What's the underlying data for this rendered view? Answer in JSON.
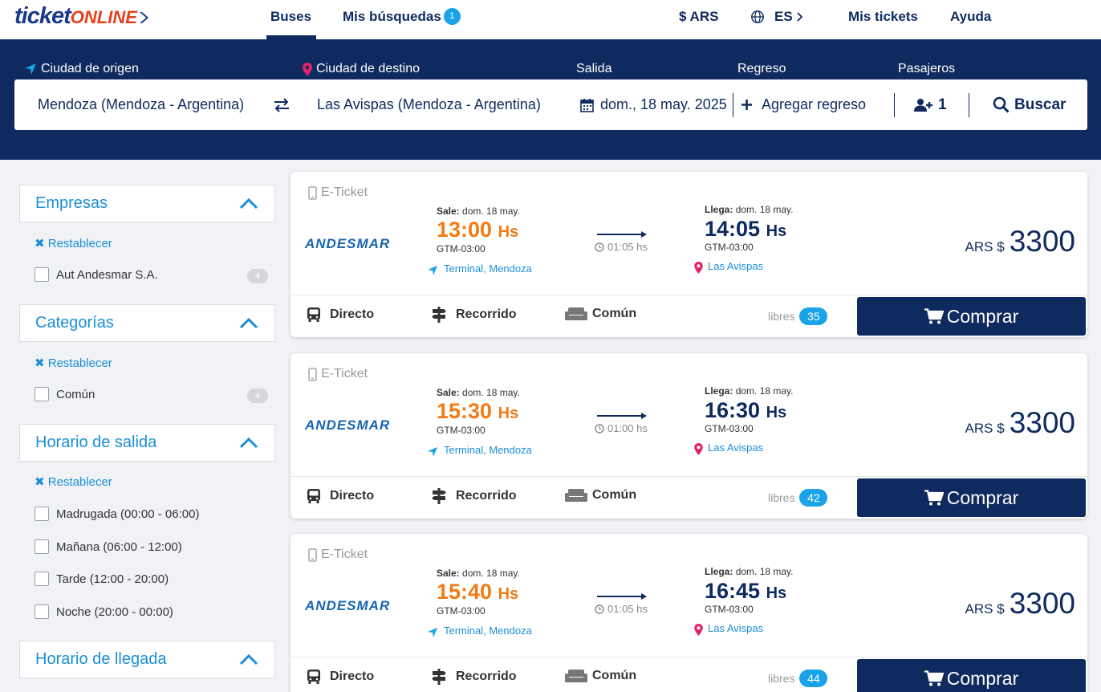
{
  "nav": {
    "logo_part1": "ticket",
    "logo_part2": "ONLINE",
    "buses": "Buses",
    "mis_busquedas": "Mis búsquedas",
    "mis_busquedas_badge": "1",
    "currency": "$ ARS",
    "language": "ES",
    "mis_tickets": "Mis tickets",
    "ayuda": "Ayuda"
  },
  "search": {
    "origin_label": "Ciudad de origen",
    "destination_label": "Ciudad de destino",
    "departure_label": "Salida",
    "return_label": "Regreso",
    "passengers_label": "Pasajeros",
    "origin_value": "Mendoza (Mendoza - Argentina)",
    "destination_value": "Las Avispas (Mendoza - Argentina)",
    "departure_value": "dom., 18 may. 2025",
    "return_value": "Agregar regreso",
    "passengers_value": "1",
    "search_button": "Buscar"
  },
  "filters": {
    "reset_label": "Restablecer",
    "empresas": {
      "title": "Empresas",
      "options": [
        {
          "label": "Aut Andesmar S.A.",
          "count": "4"
        }
      ]
    },
    "categorias": {
      "title": "Categorías",
      "options": [
        {
          "label": "Común",
          "count": "4"
        }
      ]
    },
    "horario_salida": {
      "title": "Horario de salida",
      "options": [
        {
          "label": "Madrugada (00:00 - 06:00)"
        },
        {
          "label": "Mañana (06:00 - 12:00)"
        },
        {
          "label": "Tarde (12:00 - 20:00)"
        },
        {
          "label": "Noche (20:00 - 00:00)"
        }
      ]
    },
    "horario_llegada": {
      "title": "Horario de llegada"
    }
  },
  "results": [
    {
      "ticket_type": "E-Ticket",
      "company": "ANDESMAR",
      "sale_label": "Sale:",
      "sale_date": "dom. 18 may.",
      "departure_time": "13:00",
      "departure_hs": "Hs",
      "departure_tz": "GTM-03:00",
      "departure_place": "Terminal, Mendoza",
      "duration": "01:05 hs",
      "arrival_label": "Llega:",
      "arrival_date": "dom. 18 may.",
      "arrival_time": "14:05",
      "arrival_hs": "Hs",
      "arrival_tz": "GTM-03:00",
      "arrival_place": "Las Avispas",
      "price_currency": "ARS $",
      "price": "3300",
      "feature_direct": "Directo",
      "feature_route": "Recorrido",
      "feature_class": "Común",
      "seats_label": "libres",
      "seats": "35",
      "buy_label": "Comprar"
    },
    {
      "ticket_type": "E-Ticket",
      "company": "ANDESMAR",
      "sale_label": "Sale:",
      "sale_date": "dom. 18 may.",
      "departure_time": "15:30",
      "departure_hs": "Hs",
      "departure_tz": "GTM-03:00",
      "departure_place": "Terminal, Mendoza",
      "duration": "01:00 hs",
      "arrival_label": "Llega:",
      "arrival_date": "dom. 18 may.",
      "arrival_time": "16:30",
      "arrival_hs": "Hs",
      "arrival_tz": "GTM-03:00",
      "arrival_place": "Las Avispas",
      "price_currency": "ARS $",
      "price": "3300",
      "feature_direct": "Directo",
      "feature_route": "Recorrido",
      "feature_class": "Común",
      "seats_label": "libres",
      "seats": "42",
      "buy_label": "Comprar"
    },
    {
      "ticket_type": "E-Ticket",
      "company": "ANDESMAR",
      "sale_label": "Sale:",
      "sale_date": "dom. 18 may.",
      "departure_time": "15:40",
      "departure_hs": "Hs",
      "departure_tz": "GTM-03:00",
      "departure_place": "Terminal, Mendoza",
      "duration": "01:05 hs",
      "arrival_label": "Llega:",
      "arrival_date": "dom. 18 may.",
      "arrival_time": "16:45",
      "arrival_hs": "Hs",
      "arrival_tz": "GTM-03:00",
      "arrival_place": "Las Avispas",
      "price_currency": "ARS $",
      "price": "3300",
      "feature_direct": "Directo",
      "feature_route": "Recorrido",
      "feature_class": "Común",
      "seats_label": "libres",
      "seats": "44",
      "buy_label": "Comprar"
    }
  ],
  "colors": {
    "primary_navy": "#0e2a5e",
    "accent_blue": "#1aa3e8",
    "departure_orange": "#f27b13",
    "logo_red": "#e8401c",
    "pin_pink": "#e0246a"
  }
}
